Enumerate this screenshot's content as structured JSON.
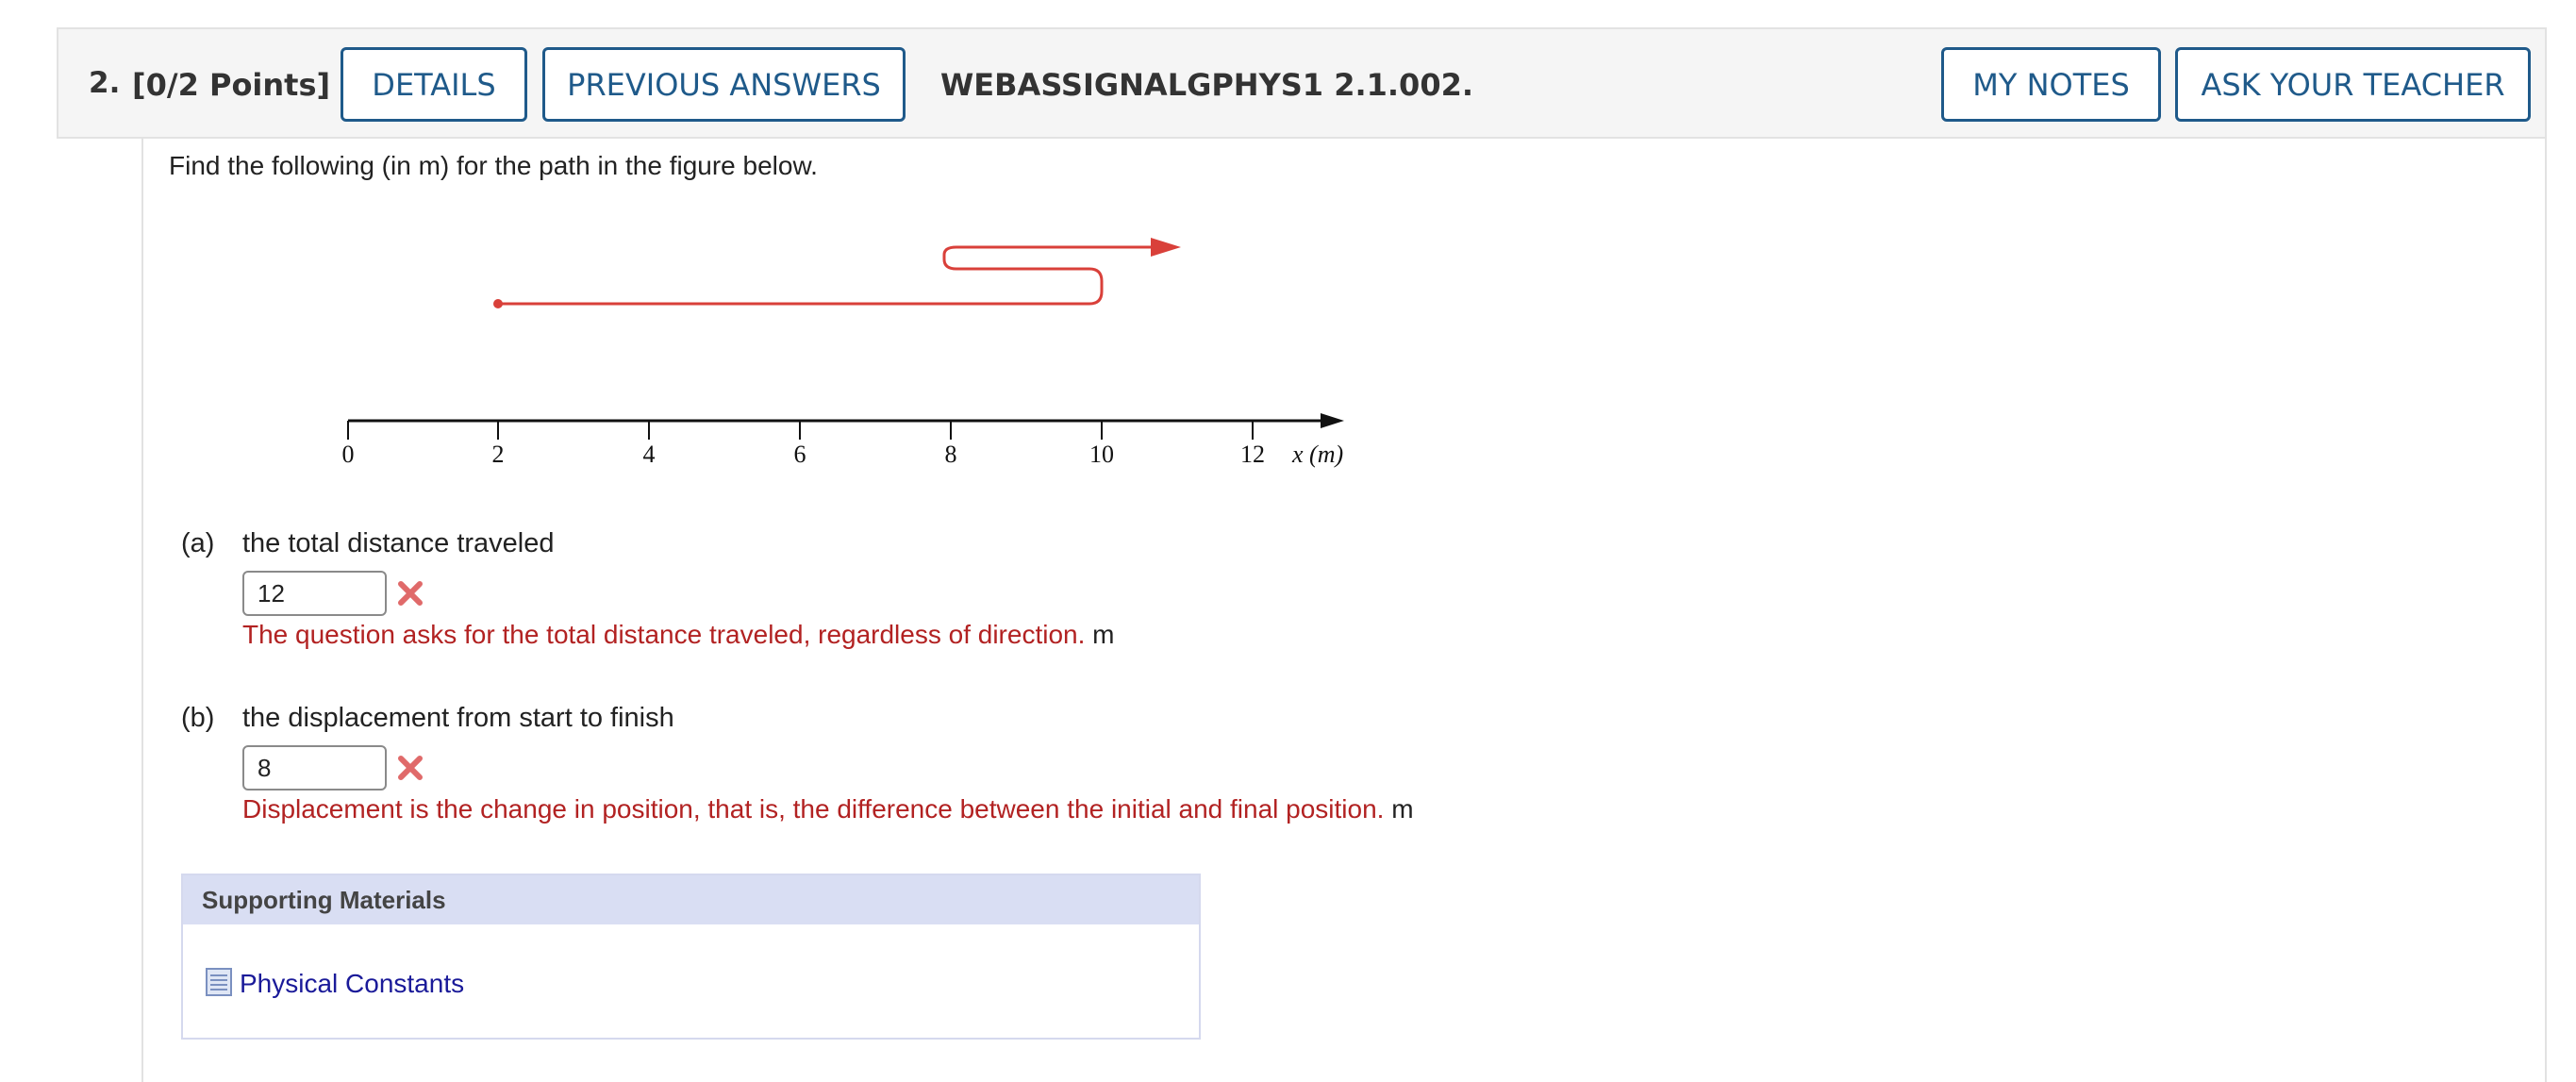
{
  "header": {
    "question_number": "2.",
    "points": "[0/2 Points]",
    "details_label": "DETAILS",
    "previous_answers_label": "PREVIOUS ANSWERS",
    "question_code": "WEBASSIGNALGPHYS1 2.1.002.",
    "my_notes_label": "MY NOTES",
    "ask_teacher_label": "ASK YOUR TEACHER",
    "button_color": "#1f5a8a"
  },
  "prompt": "Find the following (in m) for the path in the figure below.",
  "figure": {
    "axis_ticks": [
      "0",
      "2",
      "4",
      "6",
      "8",
      "10",
      "12"
    ],
    "axis_label": "x (m)",
    "path_color": "#d9403a"
  },
  "parts": [
    {
      "label": "(a)",
      "text": "the total distance traveled",
      "value": "12",
      "feedback": "The question asks for the total distance traveled, regardless of direction.",
      "unit": "m"
    },
    {
      "label": "(b)",
      "text": "the displacement from start to finish",
      "value": "8",
      "feedback": "Displacement is the change in position, that is, the difference between the initial and final position.",
      "unit": "m"
    }
  ],
  "supporting": {
    "title": "Supporting Materials",
    "link_label": "Physical Constants"
  }
}
